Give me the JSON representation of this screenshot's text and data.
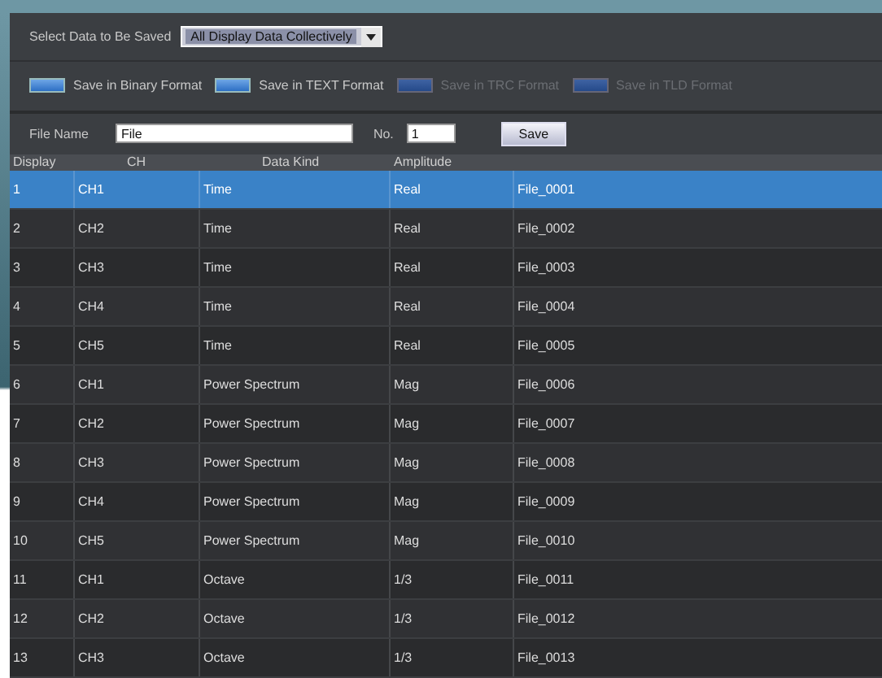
{
  "save_options": {
    "label": "Select Data to Be Saved",
    "dropdown_value": "All Display Data Collectively"
  },
  "formats": [
    {
      "label": "Save in Binary Format",
      "disabled": false
    },
    {
      "label": "Save in TEXT Format",
      "disabled": false
    },
    {
      "label": "Save in TRC Format",
      "disabled": true
    },
    {
      "label": "Save in TLD Format",
      "disabled": true
    }
  ],
  "file": {
    "name_label": "File Name",
    "name_value": "File",
    "no_label": "No.",
    "no_value": "1",
    "save_button": "Save"
  },
  "table": {
    "columns": [
      "Display",
      "CH",
      "Data Kind",
      "Amplitude"
    ],
    "rows": [
      {
        "display": "1",
        "ch": "CH1",
        "kind": "Time",
        "amplitude": "Real",
        "column_5": "File_0001",
        "selected": true
      },
      {
        "display": "2",
        "ch": "CH2",
        "kind": "Time",
        "amplitude": "Real",
        "column_5": "File_0002",
        "selected": false
      },
      {
        "display": "3",
        "ch": "CH3",
        "kind": "Time",
        "amplitude": "Real",
        "column_5": "File_0003",
        "selected": false
      },
      {
        "display": "4",
        "ch": "CH4",
        "kind": "Time",
        "amplitude": "Real",
        "column_5": "File_0004",
        "selected": false
      },
      {
        "display": "5",
        "ch": "CH5",
        "kind": "Time",
        "amplitude": "Real",
        "column_5": "File_0005",
        "selected": false
      },
      {
        "display": "6",
        "ch": "CH1",
        "kind": "Power Spectrum",
        "amplitude": "Mag",
        "column_5": "File_0006",
        "selected": false
      },
      {
        "display": "7",
        "ch": "CH2",
        "kind": "Power Spectrum",
        "amplitude": "Mag",
        "column_5": "File_0007",
        "selected": false
      },
      {
        "display": "8",
        "ch": "CH3",
        "kind": "Power Spectrum",
        "amplitude": "Mag",
        "column_5": "File_0008",
        "selected": false
      },
      {
        "display": "9",
        "ch": "CH4",
        "kind": "Power Spectrum",
        "amplitude": "Mag",
        "column_5": "File_0009",
        "selected": false
      },
      {
        "display": "10",
        "ch": "CH5",
        "kind": "Power Spectrum",
        "amplitude": "Mag",
        "column_5": "File_0010",
        "selected": false
      },
      {
        "display": "11",
        "ch": "CH1",
        "kind": "Octave",
        "amplitude": "1/3",
        "column_5": "File_0011",
        "selected": false
      },
      {
        "display": "12",
        "ch": "CH2",
        "kind": "Octave",
        "amplitude": "1/3",
        "column_5": "File_0012",
        "selected": false
      },
      {
        "display": "13",
        "ch": "CH3",
        "kind": "Octave",
        "amplitude": "1/3",
        "column_5": "File_0013",
        "selected": false
      }
    ]
  }
}
